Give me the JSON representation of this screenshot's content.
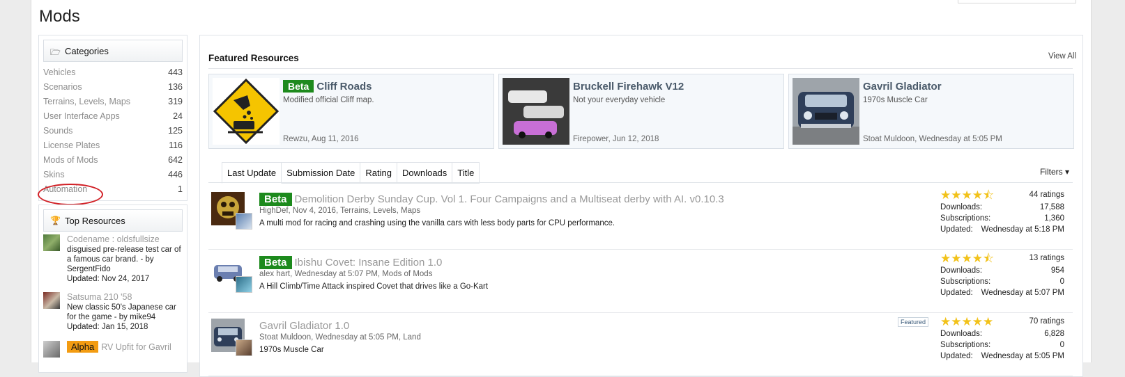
{
  "page_title": "Mods",
  "categories": {
    "heading": "Categories",
    "items": [
      {
        "name": "Vehicles",
        "count": "443"
      },
      {
        "name": "Scenarios",
        "count": "136"
      },
      {
        "name": "Terrains, Levels, Maps",
        "count": "319"
      },
      {
        "name": "User Interface Apps",
        "count": "24"
      },
      {
        "name": "Sounds",
        "count": "125"
      },
      {
        "name": "License Plates",
        "count": "116"
      },
      {
        "name": "Mods of Mods",
        "count": "642"
      },
      {
        "name": "Skins",
        "count": "446"
      },
      {
        "name": "Automation",
        "count": "1"
      }
    ]
  },
  "top_resources": {
    "heading": "Top Resources",
    "items": [
      {
        "title": "Codename : oldsfullsize",
        "desc": "disguised pre-release test car of a famous car brand. - by SergentFido",
        "updated": "Updated: Nov 24, 2017"
      },
      {
        "title": "Satsuma 210 '58",
        "desc": "New classic 50's Japanese car for the game - by mike94",
        "updated": "Updated: Jan 15, 2018"
      },
      {
        "prefix": "Alpha",
        "title": "RV Upfit for Gavril"
      }
    ]
  },
  "featured": {
    "heading": "Featured Resources",
    "view_all": "View All",
    "cards": [
      {
        "prefix": "Beta",
        "title": "Cliff Roads",
        "subtitle": "Modified official Cliff map.",
        "author": "Rewzu",
        "date": ", Aug 11, 2016"
      },
      {
        "title": "Bruckell Firehawk V12",
        "subtitle": "Not your everyday vehicle",
        "author": "Firepower",
        "date": ", Jun 12, 2018"
      },
      {
        "title": "Gavril Gladiator",
        "subtitle": "1970s Muscle Car",
        "author": "Stoat Muldoon",
        "date": ", Wednesday at 5:05 PM"
      }
    ]
  },
  "sort_tabs": [
    "Last Update",
    "Submission Date",
    "Rating",
    "Downloads",
    "Title"
  ],
  "filters_label": "Filters",
  "resources": [
    {
      "prefix": "Beta",
      "title": "Demolition Derby Sunday Cup. Vol 1. Four Campaigns and a Multiseat derby with AI.",
      "version": "v0.10.3",
      "meta": "HighDef, Nov 4, 2016, Terrains, Levels, Maps",
      "desc": "A multi mod for racing and crashing using the vanilla cars with less body parts for CPU performance.",
      "stars": "★★★★⯪",
      "ratings": "44 ratings",
      "downloads": "17,588",
      "subscriptions": "1,360",
      "updated": "Wednesday at 5:18 PM"
    },
    {
      "prefix": "Beta",
      "title": "Ibishu Covet: Insane Edition",
      "version": "1.0",
      "meta": "alex hart, Wednesday at 5:07 PM, Mods of Mods",
      "desc": "A Hill Climb/Time Attack inspired Covet that drives like a Go-Kart",
      "stars": "★★★★⯪",
      "ratings": "13 ratings",
      "downloads": "954",
      "subscriptions": "0",
      "updated": "Wednesday at 5:07 PM"
    },
    {
      "title": "Gavril Gladiator",
      "version": "1.0",
      "meta": "Stoat Muldoon, Wednesday at 5:05 PM, Land",
      "desc": "1970s Muscle Car",
      "badge": "Featured",
      "stars": "★★★★★",
      "ratings": "70 ratings",
      "downloads": "6,828",
      "subscriptions": "0",
      "updated": "Wednesday at 5:05 PM"
    }
  ],
  "stat_labels": {
    "downloads": "Downloads:",
    "subscriptions": "Subscriptions:",
    "updated": "Updated:"
  },
  "colors": {
    "beta": "#1d8a1d",
    "alpha": "#f39c12",
    "stars": "#f2c21a",
    "annotation": "#d11f25"
  }
}
